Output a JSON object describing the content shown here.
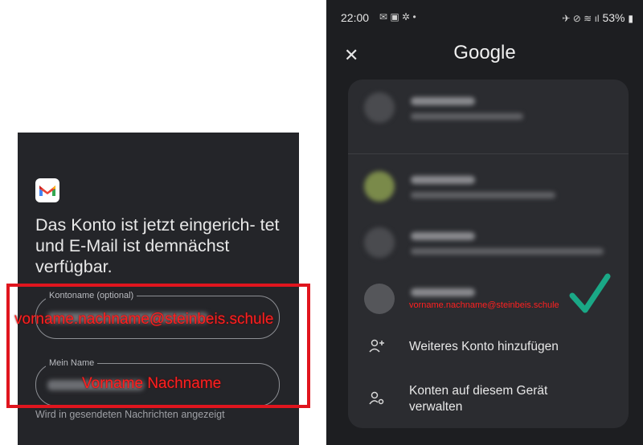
{
  "left_panel": {
    "title": "Das Konto ist jetzt eingerich- tet und E-Mail ist demnächst verfügbar.",
    "account_field_label": "Kontoname (optional)",
    "name_field_label": "Mein Name",
    "helper_text": "Wird in gesendeten Nachrichten angezeigt",
    "overlay_email": "vorname.nachname@steinbeis.schule",
    "overlay_name": "Vorname Nachname",
    "highlight_color": "#e0151e"
  },
  "right_panel": {
    "status": {
      "time": "22:00",
      "battery": "53%"
    },
    "title": "Google",
    "close_icon": "close-icon",
    "selected_email_overlay": "vorname.nachname@steinbeis.schule",
    "menu": [
      {
        "icon": "add-person-icon",
        "label": "Weiteres Konto hinzufügen"
      },
      {
        "icon": "manage-accounts-icon",
        "label": "Konten auf diesem Gerät verwalten"
      }
    ],
    "check_color": "#1aa886"
  }
}
